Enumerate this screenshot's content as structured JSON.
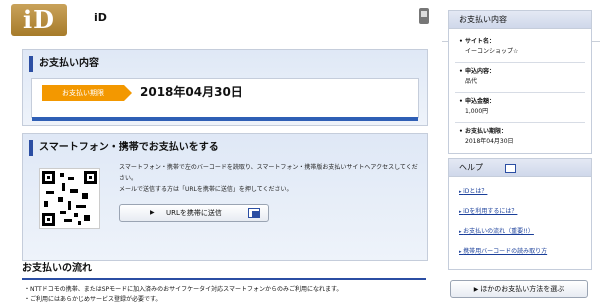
{
  "header": {
    "logo_text": "iD",
    "site_name": "iD"
  },
  "summary": {
    "title": "お支払い内容",
    "deadline_tag": "お支払い期限",
    "deadline_date": "2018年04月30日"
  },
  "smartphone": {
    "title": "スマートフォン・携帯でお支払いをする",
    "desc1": "スマートフォン・携帯で左のバーコードを読取り、スマートフォン・携帯版お支払いサイトへアクセスしてください。",
    "desc2": "メールで送信する方は「URLを携帯に送信」を押してください。",
    "send_button": "URLを携帯に送信"
  },
  "flow": {
    "title": "お支払いの流れ",
    "items": [
      "・NTTドコモの携帯、またはSPモードに加入済みのおサイフケータイ対応スマートフォンからのみご利用になれます。",
      "・ご利用にはあらかじめサービス登録が必要です。"
    ]
  },
  "sidebar": {
    "info_title": "お支払い内容",
    "items": [
      {
        "label": "サイト名：",
        "value": "イーコンショップ☆"
      },
      {
        "label": "申込内容：",
        "value": "品代"
      },
      {
        "label": "申込金額：",
        "value": "1,000円"
      },
      {
        "label": "お支払い期限：",
        "value": "2018年04月30日"
      }
    ],
    "help_title": "ヘルプ",
    "help_links": [
      "iDとは？",
      "iDを利用するには？",
      "お支払いの流れ（重要!!）",
      "携帯用バーコードの読み取り方"
    ],
    "other_button": "ほかのお支払い方法を選ぶ"
  },
  "colors": {
    "accent": "#2b4ea3",
    "deadline_orange": "#f39800",
    "link": "#1a3f9a",
    "logo_gold": "#b58a3a"
  }
}
